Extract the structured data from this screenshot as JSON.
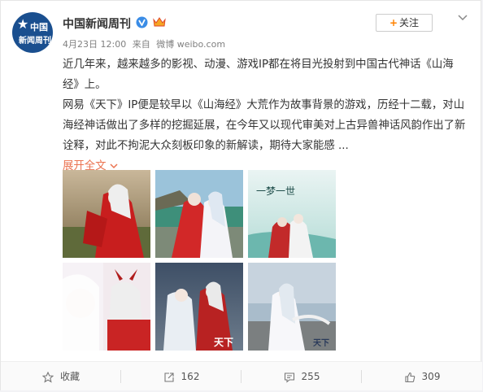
{
  "post": {
    "username": "中国新闻周刊",
    "avatar_line1": "中国",
    "avatar_line2": "新闻周刊",
    "date": "4月23日 12:00",
    "source_prefix": "来自",
    "source": "微博 weibo.com",
    "follow_label": "关注",
    "paragraph1": "近几年来，越来越多的影视、动漫、游戏IP都在将目光投射到中国古代神话《山海经》上。",
    "paragraph2": "网易《天下》IP便是较早以《山海经》大荒作为故事背景的游戏，历经十二载，对山海经神话做出了多样的挖掘延展，在今年又以现代审美对上古异兽神话风韵作出了新诠释，对此不拘泥大众刻板印象的新解读，期待大家能感 ...",
    "expand_label": "展开全文",
    "expand_icon": "chevron-down-icon"
  },
  "images": [
    {
      "name": "photo-1",
      "watermark": ""
    },
    {
      "name": "photo-2",
      "watermark": ""
    },
    {
      "name": "photo-3",
      "watermark": "一梦一世"
    },
    {
      "name": "photo-4",
      "watermark": ""
    },
    {
      "name": "photo-5",
      "watermark": "天下"
    },
    {
      "name": "photo-6",
      "watermark": "天下"
    }
  ],
  "footer": {
    "favorite_label": "收藏",
    "repost_count": "162",
    "comment_count": "255",
    "like_count": "309"
  },
  "colors": {
    "accent": "#ff8200",
    "expand_link": "#eb7350",
    "avatar_bg": "#1a4f8f"
  }
}
